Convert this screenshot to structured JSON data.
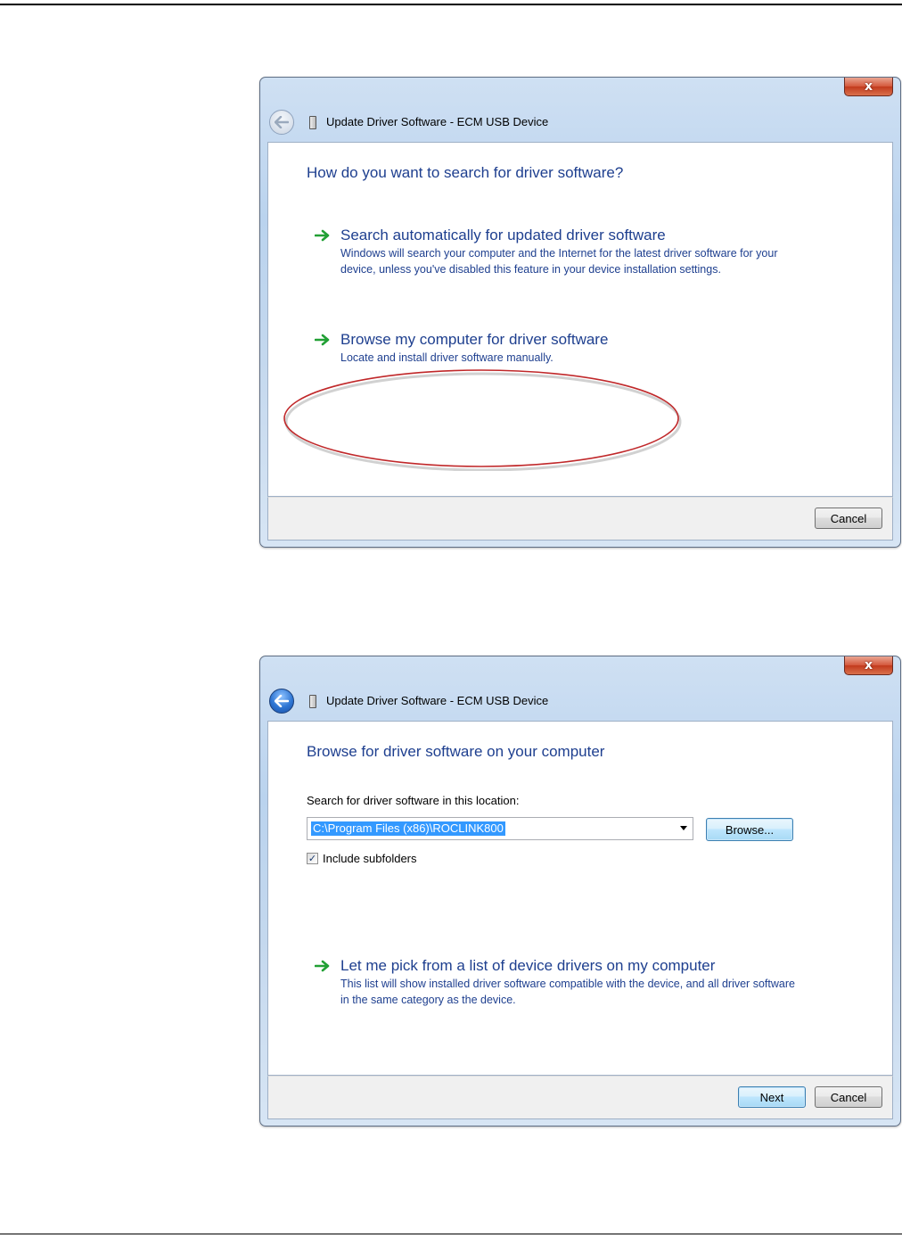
{
  "dialog1": {
    "title": "Update Driver Software - ECM USB Device",
    "close_glyph": "x",
    "heading": "How do you want to search for driver software?",
    "options": [
      {
        "title": "Search automatically for updated driver software",
        "description": "Windows will search your computer and the Internet for the latest driver software for your device, unless you've disabled this feature in your device installation settings.",
        "icon": "green-arrow-icon"
      },
      {
        "title": "Browse my computer for driver software",
        "description": "Locate and install driver software manually.",
        "icon": "green-arrow-icon",
        "highlighted": true
      }
    ],
    "cancel_label": "Cancel",
    "back_enabled": false
  },
  "dialog2": {
    "title": "Update Driver Software - ECM USB Device",
    "close_glyph": "x",
    "heading": "Browse for driver software on your computer",
    "location_label": "Search for driver software in this location:",
    "location_value": "C:\\Program Files (x86)\\ROCLINK800",
    "browse_label": "Browse...",
    "include_subfolders_label": "Include subfolders",
    "include_subfolders_checked": true,
    "check_glyph": "✓",
    "pick_option": {
      "title": "Let me pick from a list of device drivers on my computer",
      "description": "This list will show installed driver software compatible with the device, and all driver software in the same category as the device.",
      "icon": "green-arrow-icon"
    },
    "next_label": "Next",
    "cancel_label": "Cancel",
    "back_enabled": true
  },
  "colors": {
    "heading_blue": "#1e3f8f",
    "arrow_green": "#22a035",
    "highlight_red": "#c0282a",
    "selection_blue": "#3399ff"
  }
}
